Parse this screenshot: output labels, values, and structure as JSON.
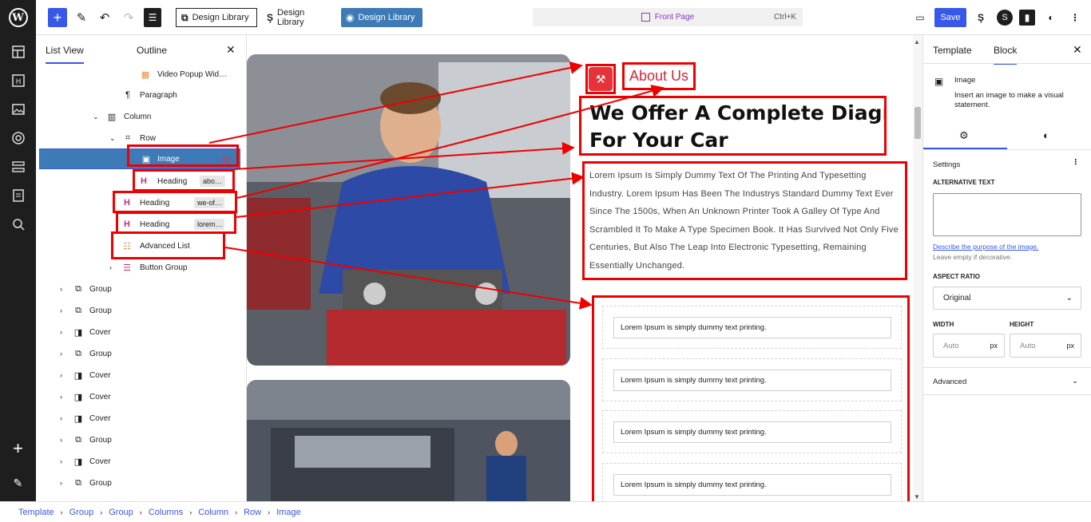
{
  "toolbar": {
    "design_library_1": "Design Library",
    "design_library_2": "Design Library",
    "design_library_3": "Design Library",
    "command_label": "Front Page",
    "command_shortcut": "Ctrl+K",
    "save_label": "Save"
  },
  "list_view": {
    "tab_list": "List View",
    "tab_outline": "Outline",
    "items": [
      {
        "label": "Video Popup Wid…",
        "icon": "video-popup-icon",
        "level": 5
      },
      {
        "label": "Paragraph",
        "icon": "paragraph-icon",
        "level": 4
      },
      {
        "label": "Column",
        "icon": "column-icon",
        "level": 3,
        "expanded": true
      },
      {
        "label": "Row",
        "icon": "row-icon",
        "level": 4,
        "expanded": true
      },
      {
        "label": "Image",
        "icon": "image-icon",
        "level": 5,
        "selected": true
      },
      {
        "label": "Heading",
        "tag": "abo…",
        "icon": "heading-icon",
        "level": 5
      },
      {
        "label": "Heading",
        "tag": "we-of…",
        "icon": "heading-icon",
        "level": 5
      },
      {
        "label": "Heading",
        "tag": "lorem…",
        "icon": "heading-icon",
        "level": 5
      },
      {
        "label": "Advanced List",
        "icon": "list-icon",
        "level": 5
      },
      {
        "label": "Button Group",
        "icon": "button-group-icon",
        "level": 5
      },
      {
        "label": "Group",
        "icon": "group-icon",
        "level": 1
      },
      {
        "label": "Group",
        "icon": "group-icon",
        "level": 1
      },
      {
        "label": "Cover",
        "icon": "cover-icon",
        "level": 1
      },
      {
        "label": "Group",
        "icon": "group-icon",
        "level": 1
      },
      {
        "label": "Cover",
        "icon": "cover-icon",
        "level": 1
      },
      {
        "label": "Cover",
        "icon": "cover-icon",
        "level": 1
      },
      {
        "label": "Cover",
        "icon": "cover-icon",
        "level": 1
      },
      {
        "label": "Group",
        "icon": "group-icon",
        "level": 1
      },
      {
        "label": "Cover",
        "icon": "cover-icon",
        "level": 1
      },
      {
        "label": "Group",
        "icon": "group-icon",
        "level": 1
      }
    ]
  },
  "canvas": {
    "about_label": "About Us",
    "heading_line1": "We Offer A Complete Diagnostic",
    "heading_line2": "For Your Car",
    "paragraph": "Lorem Ipsum Is Simply Dummy Text Of The Printing And Typesetting Industry. Lorem Ipsum Has Been The Industrys Standard Dummy Text Ever Since The 1500s, When An Unknown Printer Took A Galley Of Type And Scrambled It To Make A Type Specimen Book. It Has Survived Not Only Five Centuries, But Also The Leap Into Electronic Typesetting, Remaining Essentially Unchanged.",
    "list_items": [
      "Lorem Ipsum is simply dummy text printing.",
      "Lorem Ipsum is simply dummy text printing.",
      "Lorem Ipsum is simply dummy text printing.",
      "Lorem Ipsum is simply dummy text printing."
    ]
  },
  "inspector": {
    "tab_template": "Template",
    "tab_block": "Block",
    "block_name": "Image",
    "block_desc": "Insert an image to make a visual statement.",
    "settings_label": "Settings",
    "alt_text_label": "ALTERNATIVE TEXT",
    "alt_text_value": "",
    "alt_link": "Describe the purpose of the image.",
    "alt_hint": "Leave empty if decorative.",
    "aspect_label": "ASPECT RATIO",
    "aspect_value": "Original",
    "width_label": "WIDTH",
    "height_label": "HEIGHT",
    "width_placeholder": "Auto",
    "height_placeholder": "Auto",
    "unit": "px",
    "advanced_label": "Advanced"
  },
  "breadcrumb": [
    "Template",
    "Group",
    "Group",
    "Columns",
    "Column",
    "Row",
    "Image"
  ],
  "colors": {
    "accent": "#3858e9",
    "annotation": "#e00000",
    "brand_red": "#d6253a",
    "selected_row": "#3d7ab6"
  }
}
